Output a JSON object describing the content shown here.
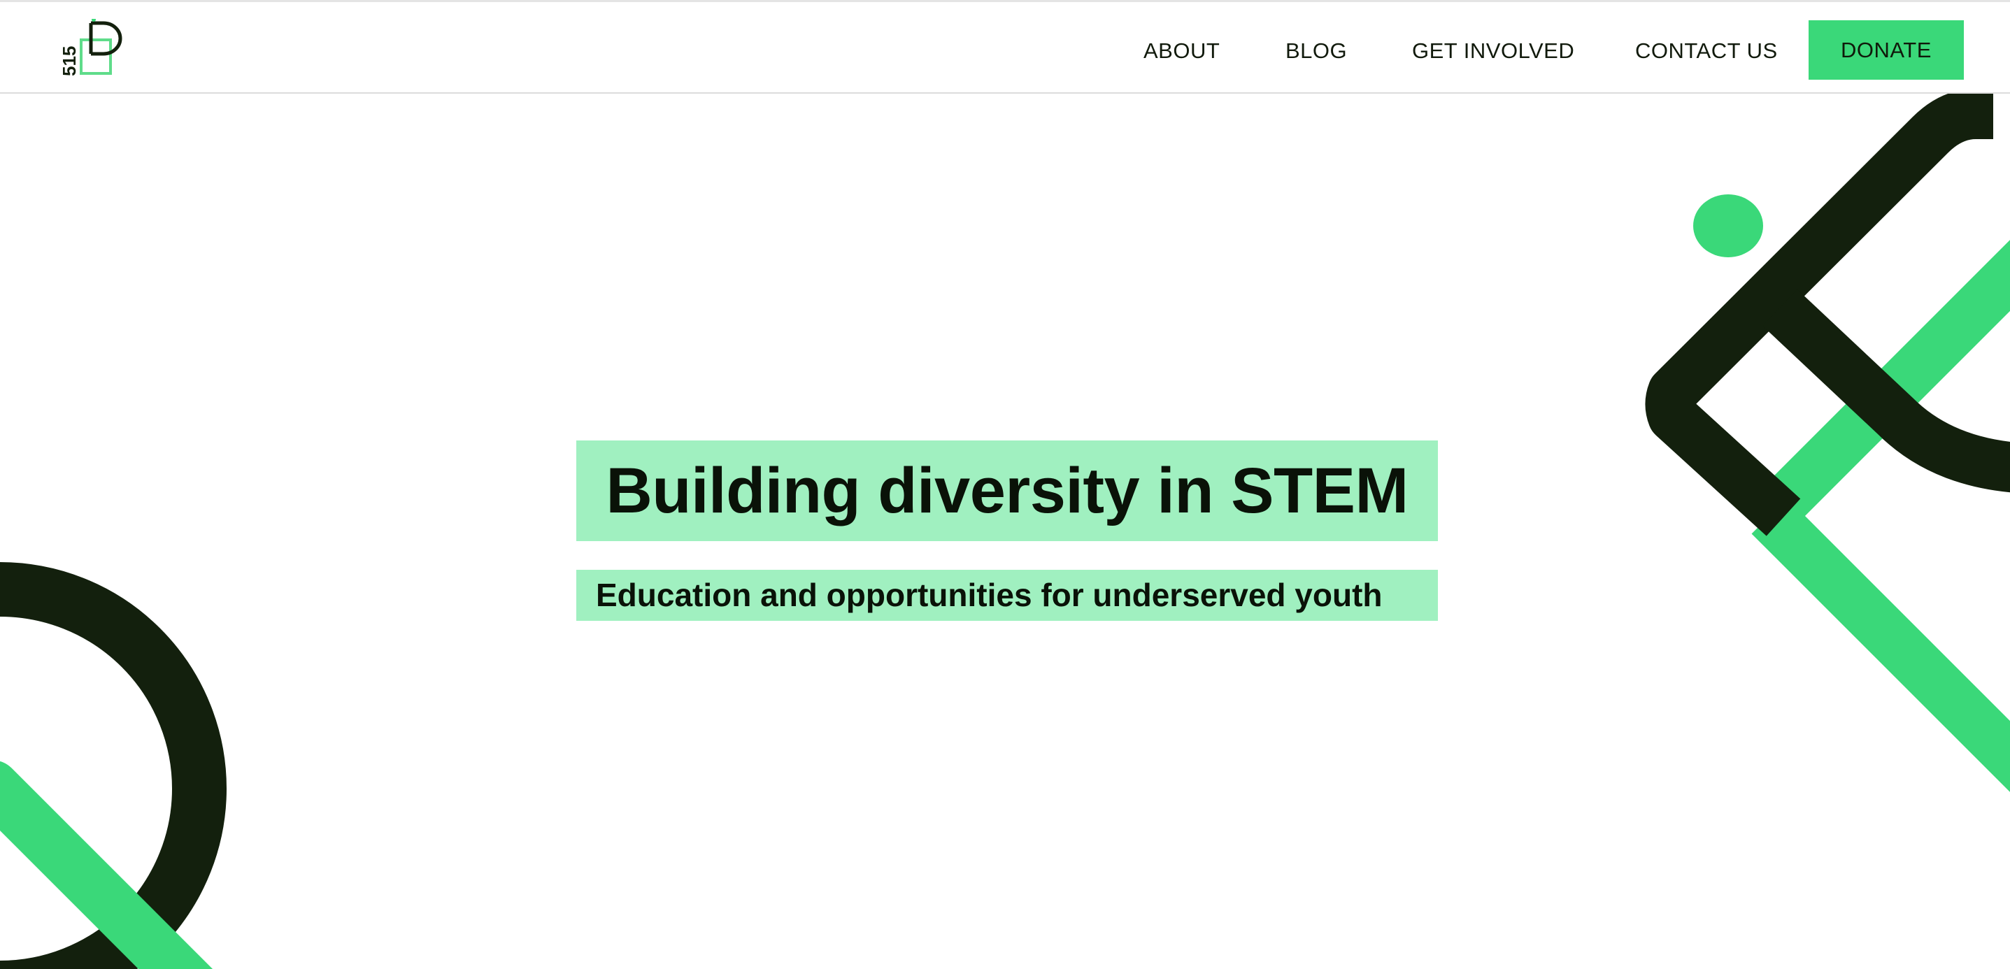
{
  "brand": {
    "logo_text": "515",
    "colors": {
      "accent": "#3ad879",
      "accent_light": "#a0f0c0",
      "dark": "#13200d"
    }
  },
  "nav": {
    "items": [
      {
        "label": "ABOUT"
      },
      {
        "label": "BLOG"
      },
      {
        "label": "GET INVOLVED"
      },
      {
        "label": "CONTACT US"
      }
    ],
    "donate_label": "DONATE"
  },
  "hero": {
    "title": "Building diversity in STEM",
    "subtitle": "Education and opportunities for underserved youth"
  }
}
